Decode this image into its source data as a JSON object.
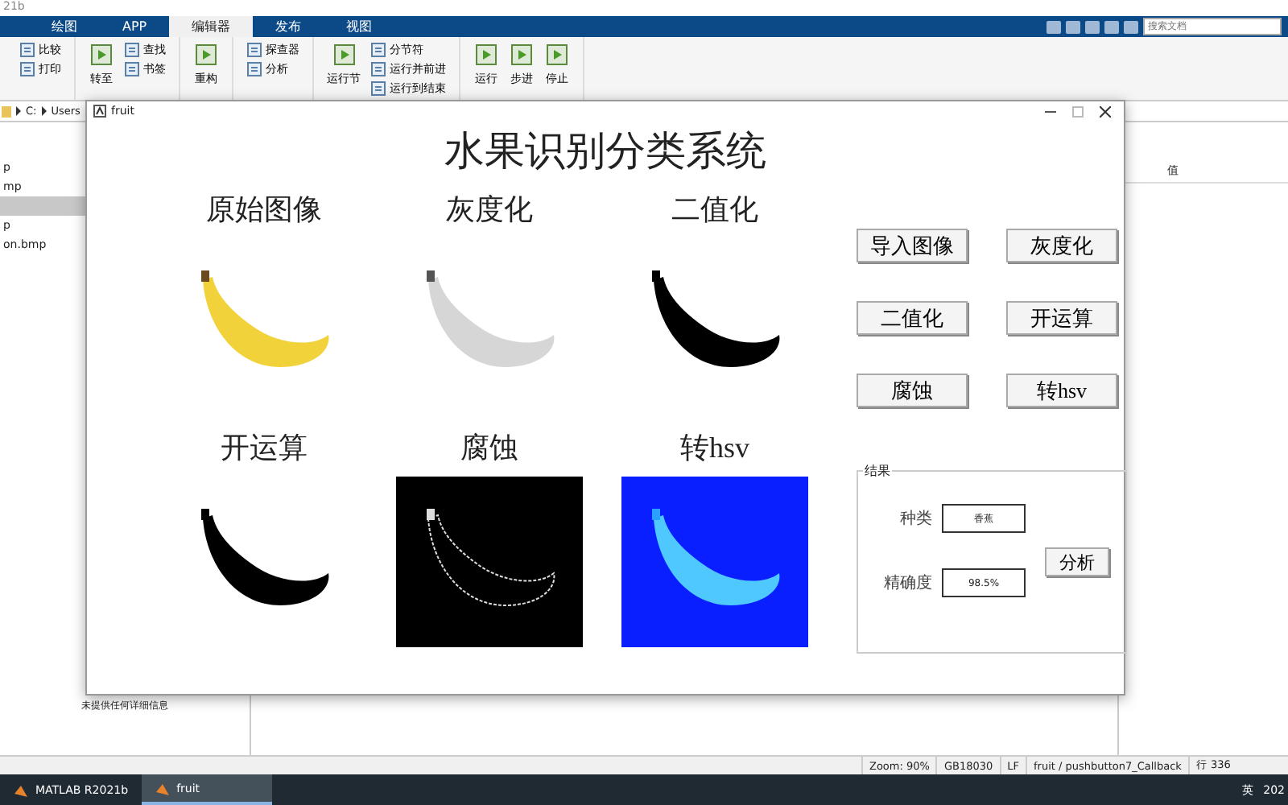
{
  "app_title": "21b",
  "tabs": [
    {
      "label": "绘图",
      "selected": false
    },
    {
      "label": "APP",
      "selected": false
    },
    {
      "label": "编辑器",
      "selected": true
    },
    {
      "label": "发布",
      "selected": false
    },
    {
      "label": "视图",
      "selected": false
    }
  ],
  "search": {
    "placeholder": "搜索文档"
  },
  "ribbon": [
    {
      "items": [
        {
          "label": "比较",
          "kind": "small"
        },
        {
          "label": "打印",
          "kind": "small"
        }
      ]
    },
    {
      "items": [
        {
          "label": "转至",
          "kind": "large"
        },
        {
          "label": "查找",
          "kind": "small"
        },
        {
          "label": "书签",
          "kind": "small"
        }
      ]
    },
    {
      "items": [
        {
          "label": "重构",
          "kind": "large"
        }
      ]
    },
    {
      "items": [
        {
          "label": "探查器",
          "kind": "small"
        },
        {
          "label": "分析",
          "kind": "small"
        }
      ]
    },
    {
      "items": [
        {
          "label": "运行节",
          "kind": "large"
        },
        {
          "label": "分节符",
          "kind": "small"
        },
        {
          "label": "运行并前进",
          "kind": "small"
        },
        {
          "label": "运行到结束",
          "kind": "small"
        }
      ]
    },
    {
      "items": [
        {
          "label": "运行",
          "kind": "large"
        },
        {
          "label": "步进",
          "kind": "large"
        },
        {
          "label": "停止",
          "kind": "large"
        }
      ]
    }
  ],
  "path": [
    "C:",
    "Users"
  ],
  "files": [
    {
      "name": "p",
      "selected": false
    },
    {
      "name": "mp",
      "selected": false
    },
    {
      "selected": true
    },
    {
      "name": "p",
      "selected": false
    },
    {
      "name": "on.bmp",
      "selected": false
    }
  ],
  "details": "未提供任何详细信息",
  "workspace": {
    "column": "值"
  },
  "status_bar": [
    "Zoom: 90%",
    "GB18030",
    "LF",
    "fruit / pushbutton7_Callback",
    "行 336"
  ],
  "taskbar": {
    "apps": [
      {
        "label": "MATLAB R2021b",
        "selected": false
      },
      {
        "label": "fruit",
        "selected": true
      }
    ],
    "ime": "英",
    "clock": "202"
  },
  "figure": {
    "title": "fruit",
    "heading": "水果识别分类系统",
    "images": [
      {
        "label": "原始图像",
        "kind": "color"
      },
      {
        "label": "灰度化",
        "kind": "gray"
      },
      {
        "label": "二值化",
        "kind": "binary"
      },
      {
        "label": "开运算",
        "kind": "opened"
      },
      {
        "label": "腐蚀",
        "kind": "eroded"
      },
      {
        "label": "转hsv",
        "kind": "hsv"
      }
    ],
    "buttons": [
      "导入图像",
      "灰度化",
      "二值化",
      "开运算",
      "腐蚀",
      "转hsv"
    ],
    "result": {
      "title": "结果",
      "fields": [
        {
          "label": "种类",
          "value": "香蕉"
        },
        {
          "label": "精确度",
          "value": "98.5%"
        }
      ],
      "button": "分析"
    }
  }
}
